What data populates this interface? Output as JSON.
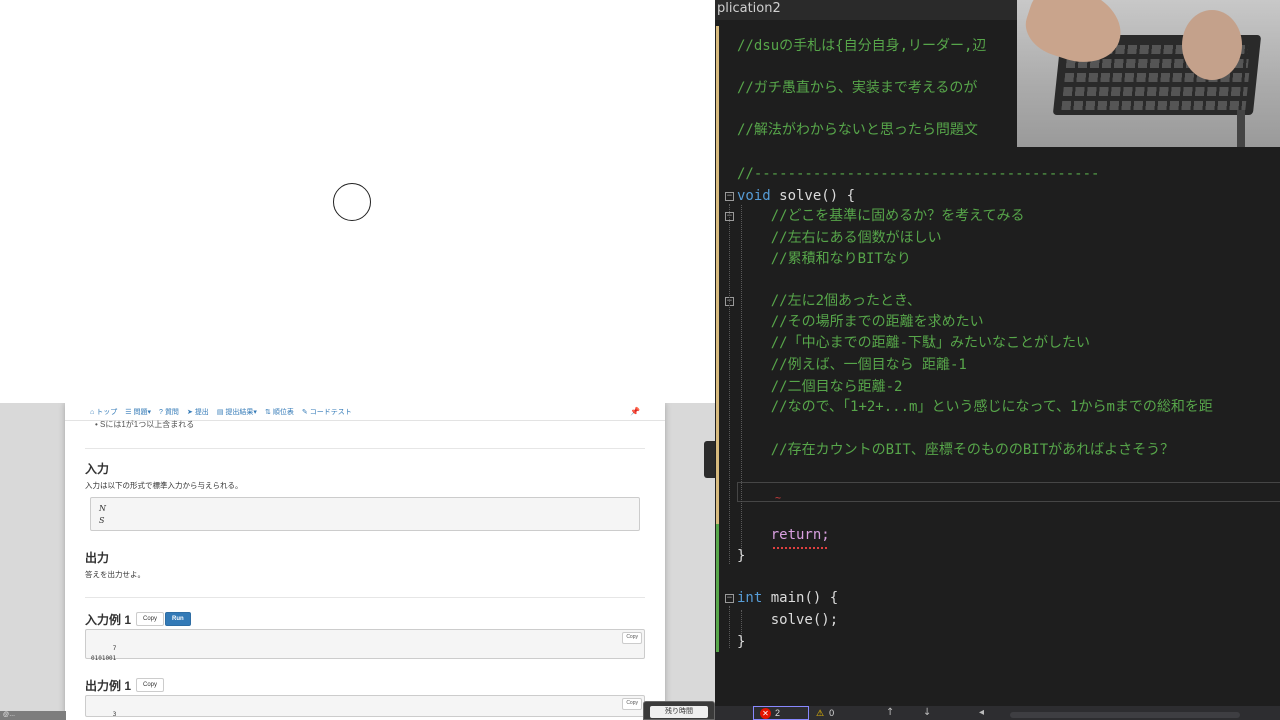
{
  "browser": {
    "navbar": {
      "items": [
        {
          "label": "トップ",
          "icon": "home-icon"
        },
        {
          "label": "問題▾",
          "icon": "list-icon"
        },
        {
          "label": "質問",
          "icon": "question-icon"
        },
        {
          "label": "提出",
          "icon": "send-icon"
        },
        {
          "label": "提出結果▾",
          "icon": "results-icon"
        },
        {
          "label": "順位表",
          "icon": "sort-icon"
        },
        {
          "label": "コードテスト",
          "icon": "wrench-icon"
        }
      ]
    },
    "cut_text": "• Sには1が1つ以上含まれる",
    "input_section": {
      "heading": "入力",
      "text": "入力は以下の形式で標準入力から与えられる。",
      "format_lines": [
        "N",
        "S"
      ]
    },
    "output_section": {
      "heading": "出力",
      "text": "答えを出力せよ。"
    },
    "sample_input_1": {
      "heading": "入力例 1",
      "copy_label": "Copy",
      "run_label": "Run",
      "content": "7\n0101001",
      "box_copy_label": "Copy"
    },
    "sample_output_1": {
      "heading": "出力例 1",
      "copy_label": "Copy",
      "content": "3",
      "box_copy_label": "Copy"
    },
    "timer_label": "残り時間",
    "left_edge_badge": "@…"
  },
  "editor": {
    "window_title": "plication2",
    "lines": [
      {
        "text": "//dsuの手札は{自分自身,リーダー,辺",
        "type": "comment"
      },
      {
        "text": "//ガチ愚直から、実装まで考えるのが",
        "type": "comment"
      },
      {
        "text": "//解法がわからないと思ったら問題文",
        "type": "comment"
      },
      {
        "text": "//-----------------------------------------",
        "type": "comment"
      },
      {
        "kw": "void",
        "rest": " solve() {"
      },
      {
        "text": "    //どこを基準に固めるか？を考えてみる",
        "type": "comment"
      },
      {
        "text": "    //左右にある個数がほしい",
        "type": "comment"
      },
      {
        "text": "    //累積和なりBITなり",
        "type": "comment"
      },
      {
        "text": "    //左に2個あったとき、",
        "type": "comment"
      },
      {
        "text": "    //その場所までの距離を求めたい",
        "type": "comment"
      },
      {
        "text": "    //「中心までの距離-下駄」みたいなことがしたい",
        "type": "comment"
      },
      {
        "text": "    //例えば、一個目なら 距離-1",
        "type": "comment"
      },
      {
        "text": "    //二個目なら距離-2",
        "type": "comment"
      },
      {
        "text": "    //なので、「1+2+...m」という感じになって、1からmまでの総和を距",
        "type": "comment"
      },
      {
        "text": "    //存在カウントのBIT、座標そのもののBITがあればよさそう？",
        "type": "comment"
      },
      {
        "text": "    return;",
        "type": "keyword2"
      },
      {
        "text": "}",
        "type": "plain"
      },
      {
        "kw": "int",
        "rest": " main() {"
      },
      {
        "text": "    solve();",
        "type": "plain"
      },
      {
        "text": "}",
        "type": "plain"
      }
    ],
    "status": {
      "errors": "2",
      "warnings": "0"
    },
    "colors": {
      "comment": "#57a64a",
      "keyword": "#569cd6",
      "background": "#1e1e1e"
    }
  }
}
